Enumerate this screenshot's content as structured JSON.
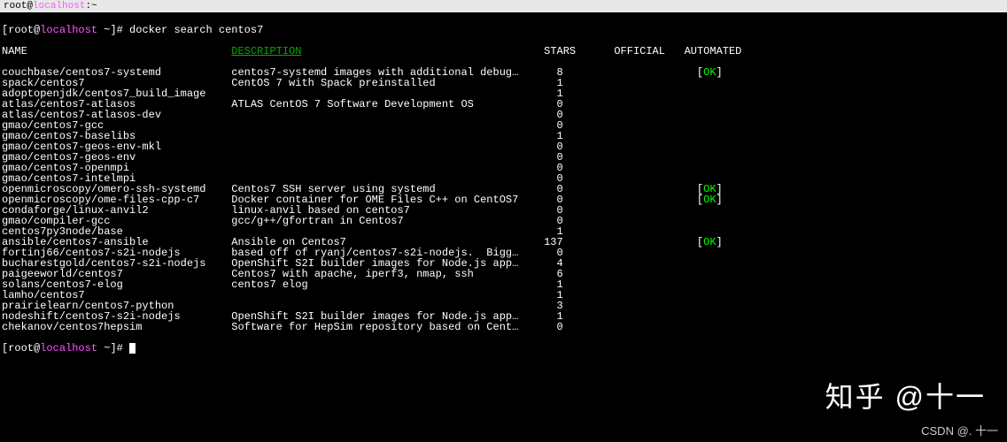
{
  "titleBar": {
    "left": "root@localhost:~",
    "user": "root",
    "host": "localhost",
    "path": "~"
  },
  "prompt": {
    "user": "root",
    "host": "localhost",
    "path": "~",
    "command": "docker search centos7"
  },
  "headers": {
    "name": "NAME",
    "description": "DESCRIPTION",
    "stars": "STARS",
    "official": "OFFICIAL",
    "automated": "AUTOMATED"
  },
  "rows": [
    {
      "name": "couchbase/centos7-systemd",
      "desc": "centos7-systemd images with additional debug…",
      "stars": "8",
      "official": "",
      "automated": "[OK]"
    },
    {
      "name": "spack/centos7",
      "desc": "CentOS 7 with Spack preinstalled",
      "stars": "1",
      "official": "",
      "automated": ""
    },
    {
      "name": "adoptopenjdk/centos7_build_image",
      "desc": "",
      "stars": "1",
      "official": "",
      "automated": ""
    },
    {
      "name": "atlas/centos7-atlasos",
      "desc": "ATLAS CentOS 7 Software Development OS",
      "stars": "0",
      "official": "",
      "automated": ""
    },
    {
      "name": "atlas/centos7-atlasos-dev",
      "desc": "",
      "stars": "0",
      "official": "",
      "automated": ""
    },
    {
      "name": "gmao/centos7-gcc",
      "desc": "",
      "stars": "0",
      "official": "",
      "automated": ""
    },
    {
      "name": "gmao/centos7-baselibs",
      "desc": "",
      "stars": "1",
      "official": "",
      "automated": ""
    },
    {
      "name": "gmao/centos7-geos-env-mkl",
      "desc": "",
      "stars": "0",
      "official": "",
      "automated": ""
    },
    {
      "name": "gmao/centos7-geos-env",
      "desc": "",
      "stars": "0",
      "official": "",
      "automated": ""
    },
    {
      "name": "gmao/centos7-openmpi",
      "desc": "",
      "stars": "0",
      "official": "",
      "automated": ""
    },
    {
      "name": "gmao/centos7-intelmpi",
      "desc": "",
      "stars": "0",
      "official": "",
      "automated": ""
    },
    {
      "name": "openmicroscopy/omero-ssh-systemd",
      "desc": "Centos7 SSH server using systemd",
      "stars": "0",
      "official": "",
      "automated": "[OK]"
    },
    {
      "name": "openmicroscopy/ome-files-cpp-c7",
      "desc": "Docker container for OME Files C++ on CentOS7",
      "stars": "0",
      "official": "",
      "automated": "[OK]"
    },
    {
      "name": "condaforge/linux-anvil2",
      "desc": "linux-anvil based on centos7",
      "stars": "0",
      "official": "",
      "automated": ""
    },
    {
      "name": "gmao/compiler-gcc",
      "desc": "gcc/g++/gfortran in Centos7",
      "stars": "0",
      "official": "",
      "automated": ""
    },
    {
      "name": "centos7py3node/base",
      "desc": "",
      "stars": "1",
      "official": "",
      "automated": ""
    },
    {
      "name": "ansible/centos7-ansible",
      "desc": "Ansible on Centos7",
      "stars": "137",
      "official": "",
      "automated": "[OK]"
    },
    {
      "name": "fortinj66/centos7-s2i-nodejs",
      "desc": "based off of ryanj/centos7-s2i-nodejs.  Bigg…",
      "stars": "0",
      "official": "",
      "automated": ""
    },
    {
      "name": "bucharestgold/centos7-s2i-nodejs",
      "desc": "OpenShift S2I builder images for Node.js app…",
      "stars": "4",
      "official": "",
      "automated": ""
    },
    {
      "name": "paigeeworld/centos7",
      "desc": "Centos7 with apache, iperf3, nmap, ssh",
      "stars": "6",
      "official": "",
      "automated": ""
    },
    {
      "name": "solans/centos7-elog",
      "desc": "centos7 elog",
      "stars": "1",
      "official": "",
      "automated": ""
    },
    {
      "name": "lamho/centos7",
      "desc": "",
      "stars": "1",
      "official": "",
      "automated": ""
    },
    {
      "name": "prairielearn/centos7-python",
      "desc": "",
      "stars": "3",
      "official": "",
      "automated": ""
    },
    {
      "name": "nodeshift/centos7-s2i-nodejs",
      "desc": "OpenShift S2I builder images for Node.js app…",
      "stars": "1",
      "official": "",
      "automated": ""
    },
    {
      "name": "chekanov/centos7hepsim",
      "desc": "Software for HepSim repository based on Cent…",
      "stars": "0",
      "official": "",
      "automated": ""
    }
  ],
  "watermark": "知乎 @十一",
  "watermark2": "CSDN @. 十一"
}
